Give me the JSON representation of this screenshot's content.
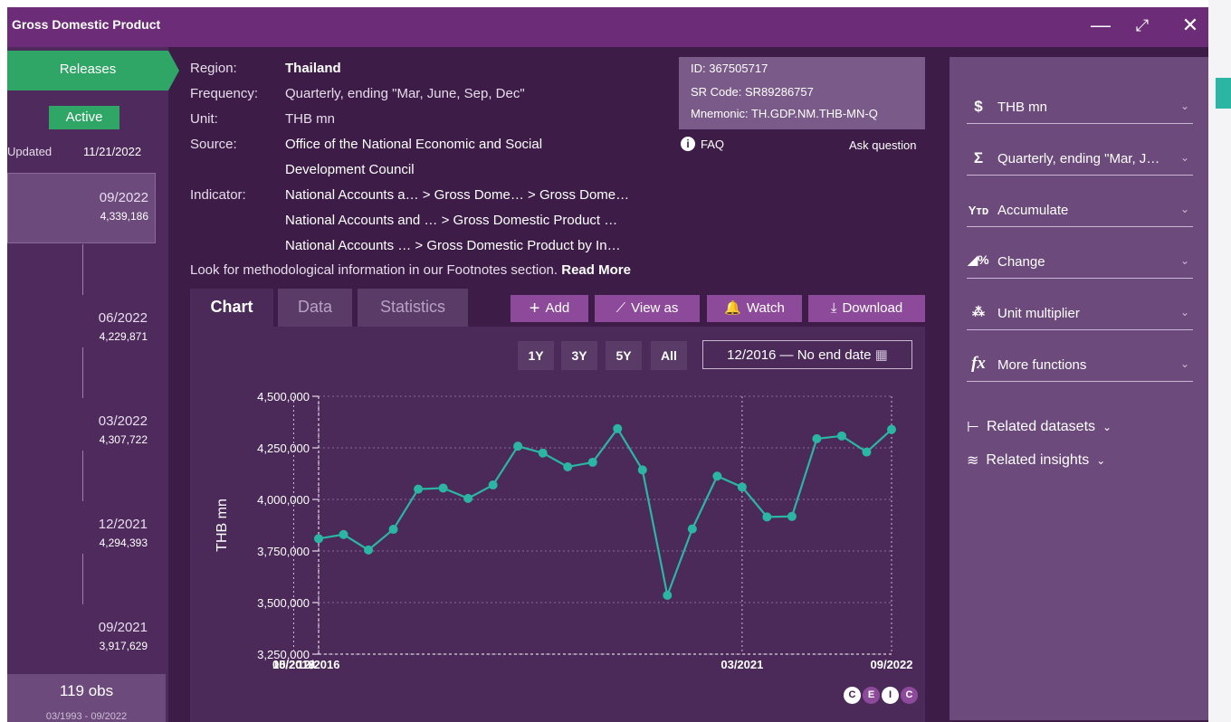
{
  "window": {
    "title": "Gross Domestic Product",
    "minimize": "—",
    "maximize": "⤢",
    "close": "✕"
  },
  "sidebar": {
    "releases_label": "Releases",
    "active_label": "Active",
    "updated_label": "Updated",
    "updated_value": "11/21/2022",
    "releases": [
      {
        "period": "09/2022",
        "value": "4,339,186",
        "selected": true
      },
      {
        "period": "06/2022",
        "value": "4,229,871"
      },
      {
        "period": "03/2022",
        "value": "4,307,722"
      },
      {
        "period": "12/2021",
        "value": "4,294,393"
      },
      {
        "period": "09/2021",
        "value": "3,917,629"
      }
    ],
    "obs_count": "119 obs",
    "obs_range": "03/1993 - 09/2022"
  },
  "meta": {
    "region_label": "Region:",
    "region": "Thailand",
    "frequency_label": "Frequency:",
    "frequency": "Quarterly, ending \"Mar, June, Sep, Dec\"",
    "unit_label": "Unit:",
    "unit": "THB mn",
    "source_label": "Source:",
    "source_1": "Office of the National Economic and Social",
    "source_2": "Development Council",
    "indicator_label": "Indicator:",
    "indicator_1": "National Accounts a… > Gross Dome… > Gross Dome…",
    "indicator_2": "National Accounts and … > Gross Domestic Product …",
    "indicator_3": "National Accounts … > Gross Domestic Product by In…",
    "footnote": "Look for methodological information in our Footnotes section.",
    "read_more": "Read More"
  },
  "idbox": {
    "id": "ID: 367505717",
    "sr_code": "SR Code: SR89286757",
    "mnemonic": "Mnemonic: TH.GDP.NM.THB-MN-Q",
    "faq": "FAQ",
    "ask": "Ask question"
  },
  "tabs": {
    "chart": "Chart",
    "data": "Data",
    "statistics": "Statistics"
  },
  "actions": {
    "add": "Add",
    "view_as": "View as",
    "watch": "Watch",
    "download": "Download"
  },
  "ranges": {
    "r1": "1Y",
    "r3": "3Y",
    "r5": "5Y",
    "all": "All",
    "date_range": "12/2016 — No end date"
  },
  "functions": [
    {
      "icon": "$",
      "label": "THB mn"
    },
    {
      "icon": "Σ",
      "label": "Quarterly, ending \"Mar, J…"
    },
    {
      "icon": "Yᴛᴅ",
      "label": "Accumulate"
    },
    {
      "icon": "◢%",
      "label": "Change"
    },
    {
      "icon": "⁂",
      "label": "Unit multiplier"
    },
    {
      "icon": "fx",
      "label": "More functions"
    }
  ],
  "related": {
    "datasets": "Related datasets",
    "insights": "Related insights"
  },
  "brand": [
    "C",
    "E",
    "I",
    "C"
  ],
  "chart_data": {
    "type": "line",
    "ylabel": "THB mn",
    "xlabel": "",
    "ylim": [
      3250000,
      4500000
    ],
    "yticks": [
      "3,250,000",
      "3,500,000",
      "3,750,000",
      "4,000,000",
      "4,250,000",
      "4,500,000"
    ],
    "ytick_values": [
      3250000,
      3500000,
      3750000,
      4000000,
      4250000,
      4500000
    ],
    "xticks": [
      "12/2016",
      "05/2018",
      "10/2019",
      "03/2021",
      "09/2022"
    ],
    "color": "#2bb6a3",
    "grid": true,
    "x": [
      "12/2016",
      "03/2017",
      "06/2017",
      "09/2017",
      "12/2017",
      "03/2018",
      "06/2018",
      "09/2018",
      "12/2018",
      "03/2019",
      "06/2019",
      "09/2019",
      "12/2019",
      "03/2020",
      "06/2020",
      "09/2020",
      "12/2020",
      "03/2021",
      "06/2021",
      "09/2021",
      "12/2021",
      "03/2022",
      "06/2022",
      "09/2022"
    ],
    "series": [
      {
        "values": [
          3810000,
          3830000,
          3755000,
          3855000,
          4050000,
          4055000,
          4005000,
          4070000,
          4258000,
          4225000,
          4158000,
          4180000,
          4343000,
          4143000,
          3535000,
          3857000,
          4113000,
          4060000,
          3915000,
          3917629,
          4294393,
          4307722,
          4229871,
          4339186
        ]
      }
    ]
  }
}
